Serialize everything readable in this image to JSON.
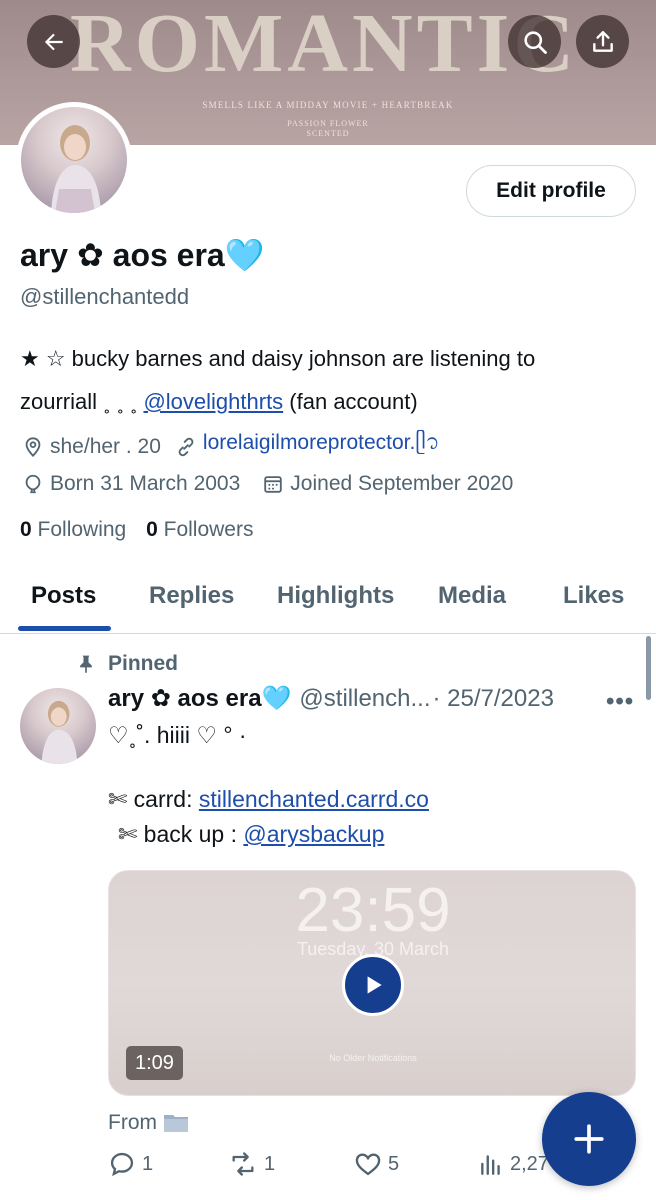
{
  "banner": {
    "word": "ROMANTIC",
    "tagline": "SMELLS LIKE A MIDDAY MOVIE + HEARTBREAK",
    "scent": "PASSION FLOWER\nSCENTED"
  },
  "header": {
    "back_icon": "arrow-left-icon",
    "search_icon": "search-icon",
    "share_icon": "share-icon"
  },
  "profile": {
    "edit_label": "Edit profile",
    "display_name": "ary ✿ aos era🩵",
    "handle": "@stillenchantedd",
    "bio_line1": "★ ☆ bucky barnes and daisy johnson are listening to",
    "bio_line2_prefix": "zourriall ˳ ˳ ˳ ",
    "bio_mention": "@lovelighthrts",
    "bio_line2_suffix": " (fan account)",
    "pronouns": "she/her . 20",
    "website": "lorelaigilmoreprotector.ᥫ᭡",
    "born": "Born 31 March 2003",
    "joined": "Joined September 2020",
    "following_count": "0",
    "following_label": "Following",
    "followers_count": "0",
    "followers_label": "Followers"
  },
  "tabs": [
    {
      "label": "Posts",
      "active": true
    },
    {
      "label": "Replies"
    },
    {
      "label": "Highlights"
    },
    {
      "label": "Media"
    },
    {
      "label": "Likes"
    }
  ],
  "post": {
    "pinned_label": "Pinned",
    "author_name": "ary ✿ aos era🩵",
    "author_handle": "@stillench...",
    "date": "· 25/7/2023",
    "more": "•••",
    "line1": "♡˳˚. hiiii ♡ ° ·",
    "carrd_prefix": "✄ carrd: ",
    "carrd_link": "stillenchanted.carrd.co",
    "backup_prefix": "✄ back up : ",
    "backup_link": "@arysbackup",
    "media": {
      "clock": "23:59",
      "date": "Tuesday, 30 March",
      "notifications": "No Older Notifications",
      "duration": "1:09"
    },
    "from_label": "From",
    "replies": "1",
    "reposts": "1",
    "likes": "5",
    "views": "2,27"
  },
  "fab_icon": "plus-icon"
}
